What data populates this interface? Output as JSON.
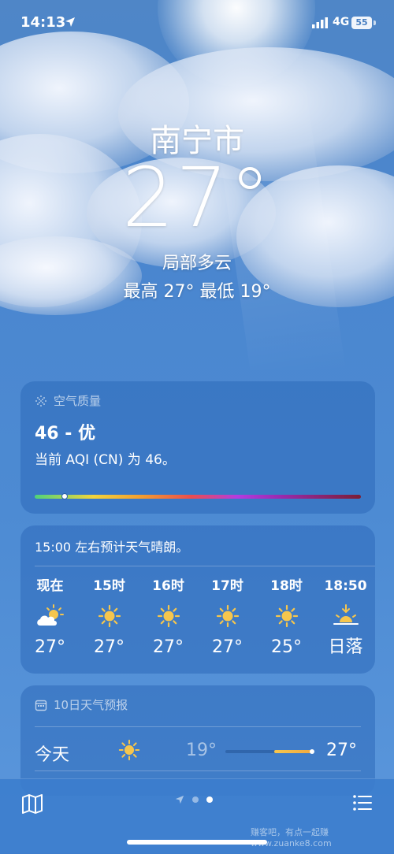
{
  "status_bar": {
    "time": "14:13",
    "network": "4G",
    "battery": "55"
  },
  "location": {
    "city": "南宁市",
    "temperature": "27°",
    "condition": "局部多云",
    "high_low": "最高 27°  最低 19°"
  },
  "air_quality": {
    "title": "空气质量",
    "value": "46 - 优",
    "description": "当前 AQI (CN) 为 46。",
    "aqi": 46
  },
  "hourly": {
    "summary": "15:00 左右预计天气晴朗。",
    "items": [
      {
        "label": "现在",
        "icon": "partly-cloudy-icon",
        "value": "27°"
      },
      {
        "label": "15时",
        "icon": "sun-icon",
        "value": "27°"
      },
      {
        "label": "16时",
        "icon": "sun-icon",
        "value": "27°"
      },
      {
        "label": "17时",
        "icon": "sun-icon",
        "value": "27°"
      },
      {
        "label": "18时",
        "icon": "sun-icon",
        "value": "25°"
      },
      {
        "label": "18:50",
        "icon": "sunset-icon",
        "value": "日落"
      }
    ]
  },
  "forecast": {
    "title": "10日天气预报",
    "rows": [
      {
        "day": "今天",
        "icon": "sun-icon",
        "low": "19°",
        "high": "27°",
        "range_start": 0.55,
        "range_end": 0.98,
        "current": 0.98
      }
    ]
  },
  "colors": {
    "sun": "#f6c64d",
    "card": "#2d69b9"
  },
  "pager": {
    "pages": 3,
    "active": 2
  },
  "watermark": "赚客吧，有点一起赚 www.zuanke8.com"
}
